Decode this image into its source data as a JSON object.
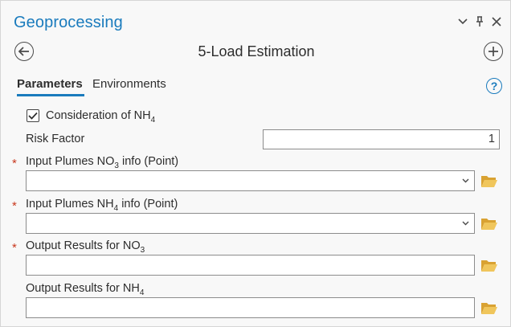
{
  "pane": {
    "title": "Geoprocessing",
    "controls": [
      "chevron-down-icon",
      "pin-icon",
      "close-icon"
    ]
  },
  "tool": {
    "title": "5-Load Estimation"
  },
  "tabs": [
    {
      "label": "Parameters",
      "active": true
    },
    {
      "label": "Environments",
      "active": false
    }
  ],
  "parameters": {
    "nh4_consideration": {
      "label_main": "Consideration of NH",
      "label_sub": "4",
      "checked": true
    },
    "risk_factor": {
      "label": "Risk Factor",
      "value": "1"
    },
    "plumes_no3": {
      "label_pre": "Input Plumes NO",
      "label_sub": "3",
      "label_post": " info (Point)",
      "required": true,
      "value": ""
    },
    "plumes_nh4": {
      "label_pre": "Input Plumes NH",
      "label_sub": "4",
      "label_post": " info (Point)",
      "required": true,
      "value": ""
    },
    "output_no3": {
      "label_pre": "Output Results for NO",
      "label_sub": "3",
      "required": true,
      "value": ""
    },
    "output_nh4": {
      "label_pre": "Output Results for NH",
      "label_sub": "4",
      "required": false,
      "value": ""
    }
  },
  "required_marker": "*",
  "colors": {
    "accent": "#1a7bbd",
    "required": "#c8381e",
    "folder": "#e8b84a"
  }
}
